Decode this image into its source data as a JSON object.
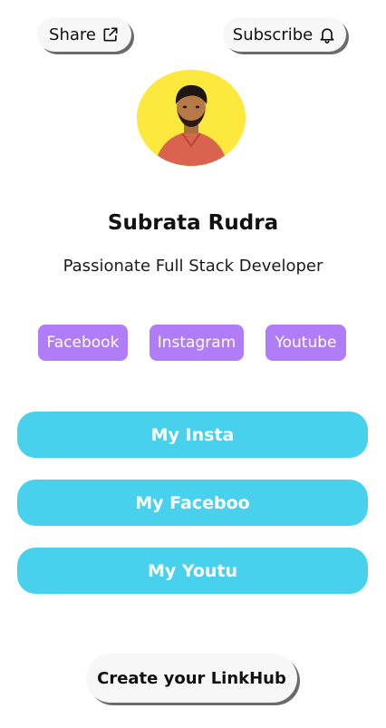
{
  "header": {
    "share_label": "Share",
    "share_icon": "share-icon",
    "subscribe_label": "Subscribe",
    "subscribe_icon": "bell-icon"
  },
  "profile": {
    "name": "Subrata Rudra",
    "bio": "Passionate Full Stack Developer",
    "avatar_bg": "#fde93d"
  },
  "social_links": [
    {
      "label": "Facebook"
    },
    {
      "label": "Instagram"
    },
    {
      "label": "Youtube"
    }
  ],
  "links": [
    {
      "label": "My Insta"
    },
    {
      "label": "My Faceboo"
    },
    {
      "label": "My Youtu"
    }
  ],
  "footer": {
    "create_label": "Create your LinkHub"
  },
  "colors": {
    "social_bg": "#b07cf7",
    "link_bg": "#48d1ec",
    "pill_bg": "#f7f7f7"
  }
}
